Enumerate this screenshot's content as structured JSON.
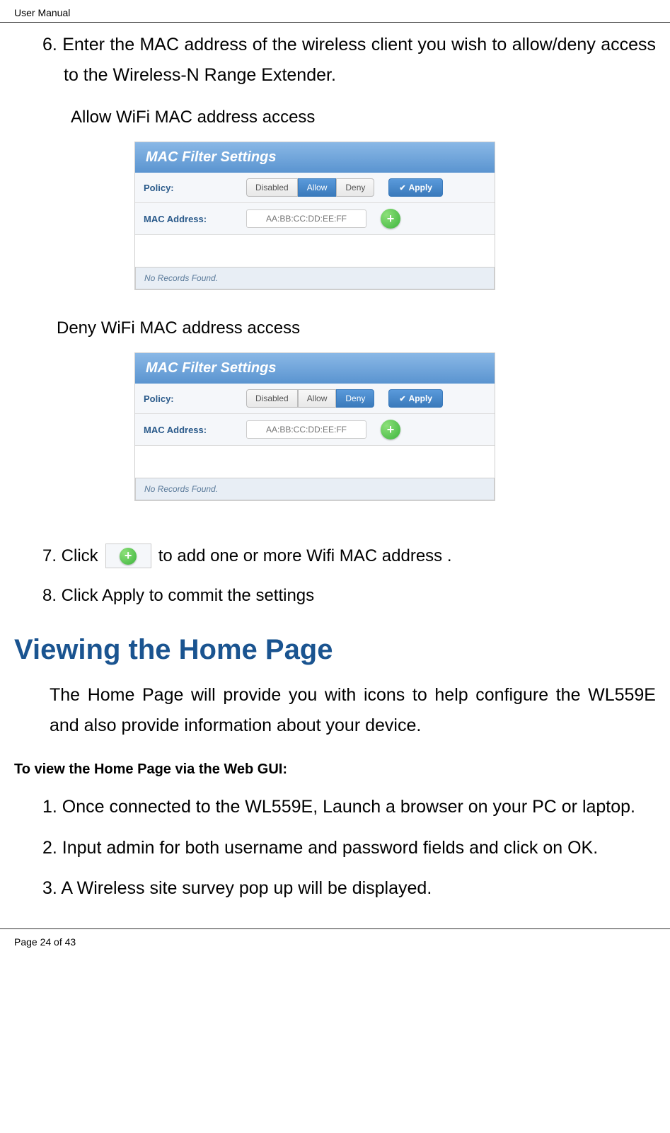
{
  "header": {
    "title": "User Manual"
  },
  "steps": {
    "step6": "6. Enter the MAC address of the wireless client you wish to allow/deny access to the Wireless-N Range Extender.",
    "allow_title": "Allow WiFi MAC address access",
    "deny_title": "Deny WiFi MAC address access",
    "step7_prefix": "7. Click",
    "step7_suffix": "to add one or more Wifi MAC address .",
    "step8": "8. Click Apply to commit the settings"
  },
  "panel": {
    "title": "MAC Filter Settings",
    "policy_label": "Policy:",
    "mac_label": "MAC Address:",
    "disabled": "Disabled",
    "allow": "Allow",
    "deny": "Deny",
    "apply": "Apply",
    "mac_placeholder": "AA:BB:CC:DD:EE:FF",
    "no_records": "No Records Found."
  },
  "section": {
    "title": "Viewing the Home Page",
    "desc": "The Home Page will provide you with icons to help configure the WL559E and also provide information about your device.",
    "subheading": "To view the Home Page via the Web GUI:",
    "steps": {
      "s1": "1. Once connected to the WL559E, Launch a browser on your PC or laptop.",
      "s2": "2. Input admin for both username and password fields and click on OK.",
      "s3": "3. A Wireless site survey pop up will be displayed."
    }
  },
  "footer": {
    "page": "Page 24 of 43"
  }
}
